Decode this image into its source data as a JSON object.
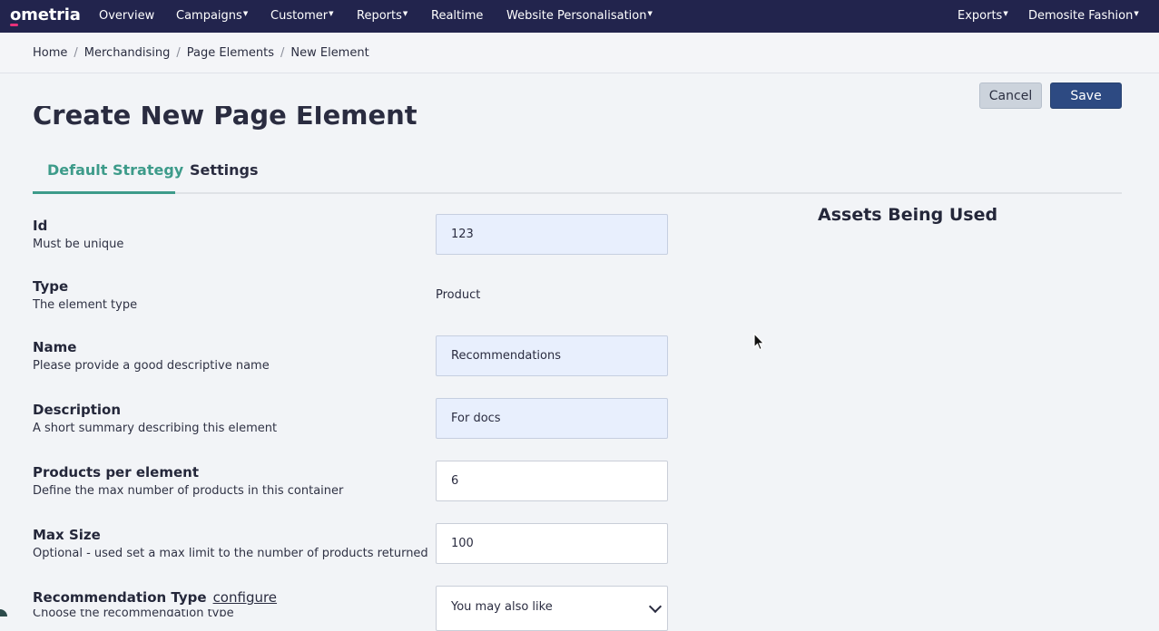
{
  "nav": {
    "logo": "ometria",
    "items": [
      "Overview",
      "Campaigns",
      "Customer",
      "Reports",
      "Realtime",
      "Website Personalisation"
    ],
    "right": [
      "Exports",
      "Demosite Fashion"
    ]
  },
  "breadcrumb": [
    "Home",
    "Merchandising",
    "Page Elements",
    "New Element"
  ],
  "actions": {
    "cancel": "Cancel",
    "save": "Save"
  },
  "page_title": "Create New Page Element",
  "tabs": [
    "Default Strategy",
    "Settings"
  ],
  "form": {
    "id": {
      "label": "Id",
      "help": "Must be unique",
      "value": "123"
    },
    "type": {
      "label": "Type",
      "help": "The element type",
      "value": "Product"
    },
    "name": {
      "label": "Name",
      "help": "Please provide a good descriptive name",
      "value": "Recommendations"
    },
    "description": {
      "label": "Description",
      "help": "A short summary describing this element",
      "value": "For docs"
    },
    "products_per_element": {
      "label": "Products per element",
      "help": "Define the max number of products in this container",
      "value": "6"
    },
    "max_size": {
      "label": "Max Size",
      "help": "Optional - used set a max limit to the number of products returned",
      "value": "100"
    },
    "recommendation_type": {
      "label": "Recommendation Type",
      "link": "configure",
      "help": "Choose the recommendation type",
      "value": "You may also like"
    }
  },
  "assets_heading": "Assets Being Used",
  "colors": {
    "nav_bg": "#22244d",
    "accent": "#3d9b8a",
    "primary": "#2d4a82"
  }
}
